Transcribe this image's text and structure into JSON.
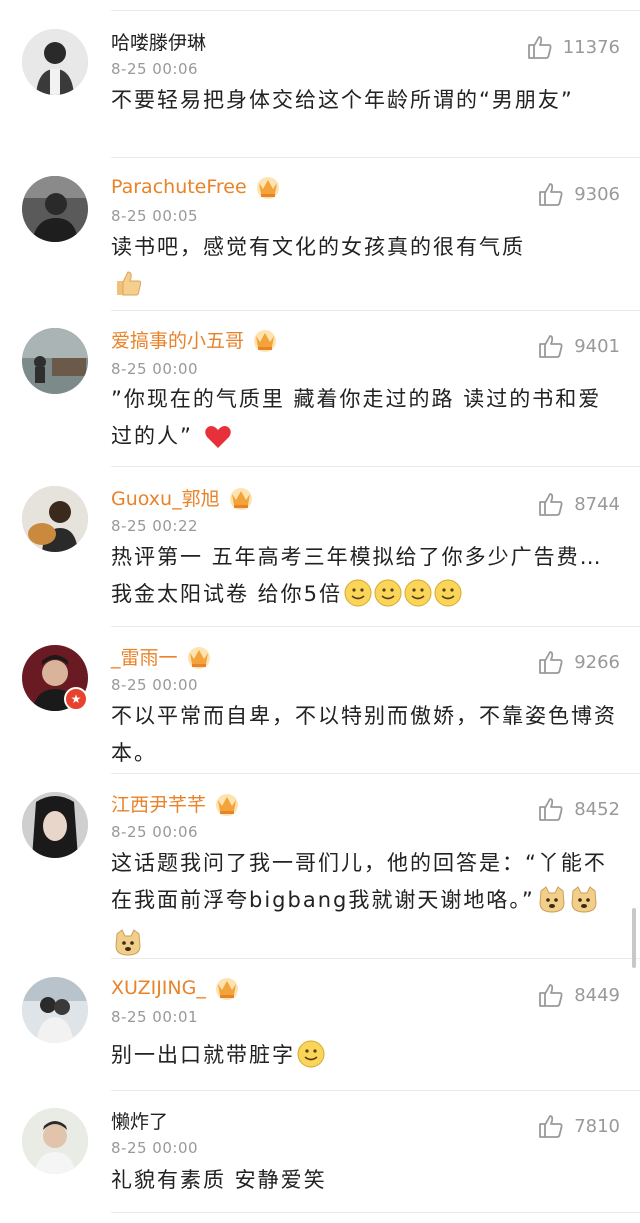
{
  "comments": [
    {
      "name": "哈喽滕伊琳",
      "vip": false,
      "time": "8-25 00:06",
      "likes": "11376",
      "text": "不要轻易把身体交给这个年龄所谓的“男朋友”",
      "emoji": []
    },
    {
      "name": "ParachuteFree",
      "vip": true,
      "time": "8-25 00:05",
      "likes": "9306",
      "text": "读书吧，感觉有文化的女孩真的很有气质",
      "emoji": [
        "thumbs-up"
      ]
    },
    {
      "name": "爱搞事的小五哥",
      "vip": true,
      "time": "8-25 00:00",
      "likes": "9401",
      "text": "”你现在的气质里 藏着你走过的路 读过的书和爱过的人”",
      "emoji": [
        "heart"
      ]
    },
    {
      "name": "Guoxu_郭旭",
      "vip": true,
      "time": "8-25 00:22",
      "likes": "8744",
      "text": "热评第一 五年高考三年模拟给了你多少广告费…我金太阳试卷 给你5倍",
      "emoji": [
        "smile",
        "smile",
        "smile",
        "smile"
      ]
    },
    {
      "name": "_雷雨一",
      "vip": true,
      "time": "8-25 00:00",
      "likes": "9266",
      "text": "不以平常而自卑，不以特别而傲娇，不靠姿色博资本。",
      "emoji": []
    },
    {
      "name": "江西尹芊芊",
      "vip": true,
      "time": "8-25 00:06",
      "likes": "8452",
      "text": "这话题我问了我一哥们儿，他的回答是：“丫能不在我面前浮夸bigbang我就谢天谢地咯。”",
      "emoji": [
        "doge",
        "doge",
        "doge"
      ]
    },
    {
      "name": "XUZIJING_",
      "vip": true,
      "time": "8-25 00:01",
      "likes": "8449",
      "text": "别一出口就带脏字",
      "emoji": [
        "smile"
      ]
    },
    {
      "name": "懒炸了",
      "vip": false,
      "time": "8-25 00:00",
      "likes": "7810",
      "text": "礼貌有素质 安静爱笑",
      "emoji": []
    }
  ],
  "colors": {
    "vip_name": "#e8832a",
    "meta": "#999999",
    "text": "#222222",
    "badge": "#e8412d"
  },
  "icons": {
    "like": "thumbs-up-icon",
    "vip": "crown-icon",
    "verified": "star-badge-icon"
  }
}
